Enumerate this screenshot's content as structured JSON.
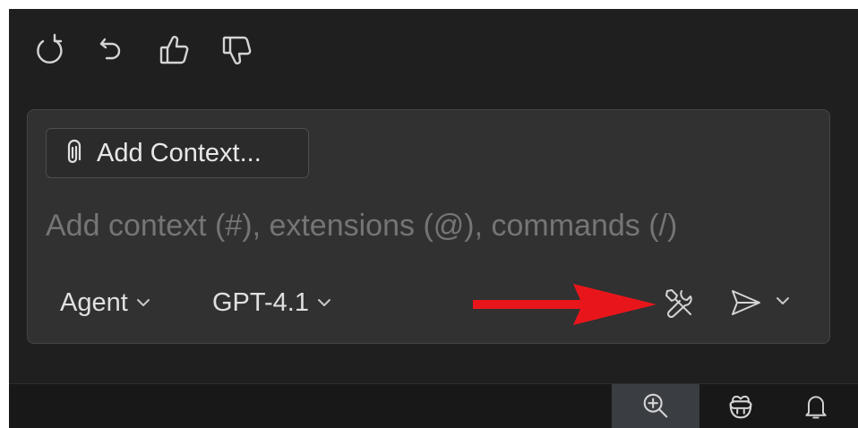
{
  "toolbar": {
    "icons": [
      "retry-icon",
      "undo-icon",
      "thumbs-up-icon",
      "thumbs-down-icon"
    ]
  },
  "chat_input": {
    "add_context_label": "Add Context...",
    "attach_icon": "paperclip-icon",
    "placeholder": "Add context (#), extensions (@), commands (/)",
    "value": ""
  },
  "pickers": {
    "mode_label": "Agent",
    "model_label": "GPT-4.1"
  },
  "actions": {
    "tools_icon": "tools-icon",
    "send_icon": "send-icon",
    "send_menu_icon": "chevron-down-icon"
  },
  "annotation": {
    "arrow_color": "#e8161b"
  },
  "statusbar": {
    "icons": [
      "zoom-in-icon",
      "copilot-icon",
      "bell-icon"
    ]
  },
  "colors": {
    "background": "#1f1f1f",
    "panel": "#313131",
    "text": "#e0e0e0",
    "placeholder": "#8a8a8a"
  }
}
